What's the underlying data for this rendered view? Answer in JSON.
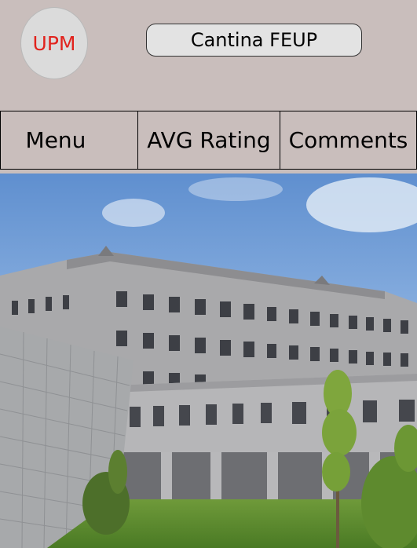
{
  "header": {
    "logo_text": "UPM",
    "title": "Cantina FEUP"
  },
  "tabs": [
    {
      "label": "Menu"
    },
    {
      "label": "AVG Rating"
    },
    {
      "label": "Comments"
    }
  ],
  "colors": {
    "background": "#c9bebc",
    "logo_text": "#e1231d"
  }
}
